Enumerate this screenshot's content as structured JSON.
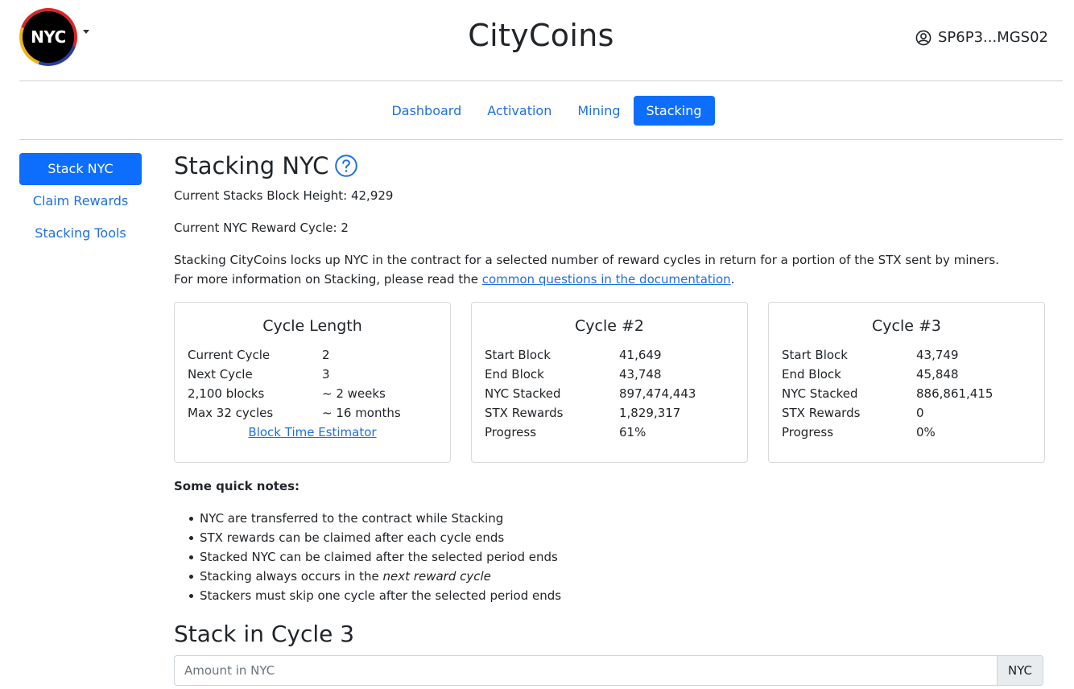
{
  "header": {
    "logo_text": "NYC",
    "app_title": "CityCoins",
    "account_label": "SP6P3...MGS02"
  },
  "nav": {
    "tabs": [
      {
        "label": "Dashboard"
      },
      {
        "label": "Activation"
      },
      {
        "label": "Mining"
      },
      {
        "label": "Stacking"
      }
    ]
  },
  "sidebar": {
    "items": [
      {
        "label": "Stack NYC"
      },
      {
        "label": "Claim Rewards"
      },
      {
        "label": "Stacking Tools"
      }
    ]
  },
  "main": {
    "title": "Stacking NYC",
    "block_height": "Current Stacks Block Height: 42,929",
    "reward_cycle": "Current NYC Reward Cycle: 2",
    "description": "Stacking CityCoins locks up NYC in the contract for a selected number of reward cycles in return for a portion of the STX sent by miners.",
    "more_info_prefix": "For more information on Stacking, please read the ",
    "more_info_link": "common questions in the documentation",
    "more_info_suffix": "."
  },
  "cards": {
    "cycle_length": {
      "title": "Cycle Length",
      "rows": [
        {
          "k": "Current Cycle",
          "v": "2"
        },
        {
          "k": "Next Cycle",
          "v": "3"
        },
        {
          "k": "2,100 blocks",
          "v": "~ 2 weeks"
        },
        {
          "k": "Max 32 cycles",
          "v": "~ 16 months"
        }
      ],
      "link": "Block Time Estimator"
    },
    "cycle2": {
      "title": "Cycle #2",
      "rows": [
        {
          "k": "Start Block",
          "v": "41,649"
        },
        {
          "k": "End Block",
          "v": "43,748"
        },
        {
          "k": "NYC Stacked",
          "v": "897,474,443"
        },
        {
          "k": "STX Rewards",
          "v": "1,829,317"
        },
        {
          "k": "Progress",
          "v": "61%"
        }
      ]
    },
    "cycle3": {
      "title": "Cycle #3",
      "rows": [
        {
          "k": "Start Block",
          "v": "43,749"
        },
        {
          "k": "End Block",
          "v": "45,848"
        },
        {
          "k": "NYC Stacked",
          "v": "886,861,415"
        },
        {
          "k": "STX Rewards",
          "v": "0"
        },
        {
          "k": "Progress",
          "v": "0%"
        }
      ]
    }
  },
  "notes": {
    "title": "Some quick notes:",
    "items": [
      "NYC are transferred to the contract while Stacking",
      "STX rewards can be claimed after each cycle ends",
      "Stacked NYC can be claimed after the selected period ends"
    ],
    "item4_prefix": "Stacking always occurs in the ",
    "item4_emphasis": "next reward cycle",
    "item5": "Stackers must skip one cycle after the selected period ends"
  },
  "stack_form": {
    "title": "Stack in Cycle 3",
    "amount_placeholder": "Amount in NYC",
    "amount_value": "",
    "unit": "NYC"
  },
  "colors": {
    "primary": "#0d6efd",
    "link": "#1f6fe5",
    "text": "#212529"
  },
  "icons": {
    "account": "user-circle-icon",
    "help": "question-circle-icon",
    "menu": "chevron-down-icon"
  }
}
